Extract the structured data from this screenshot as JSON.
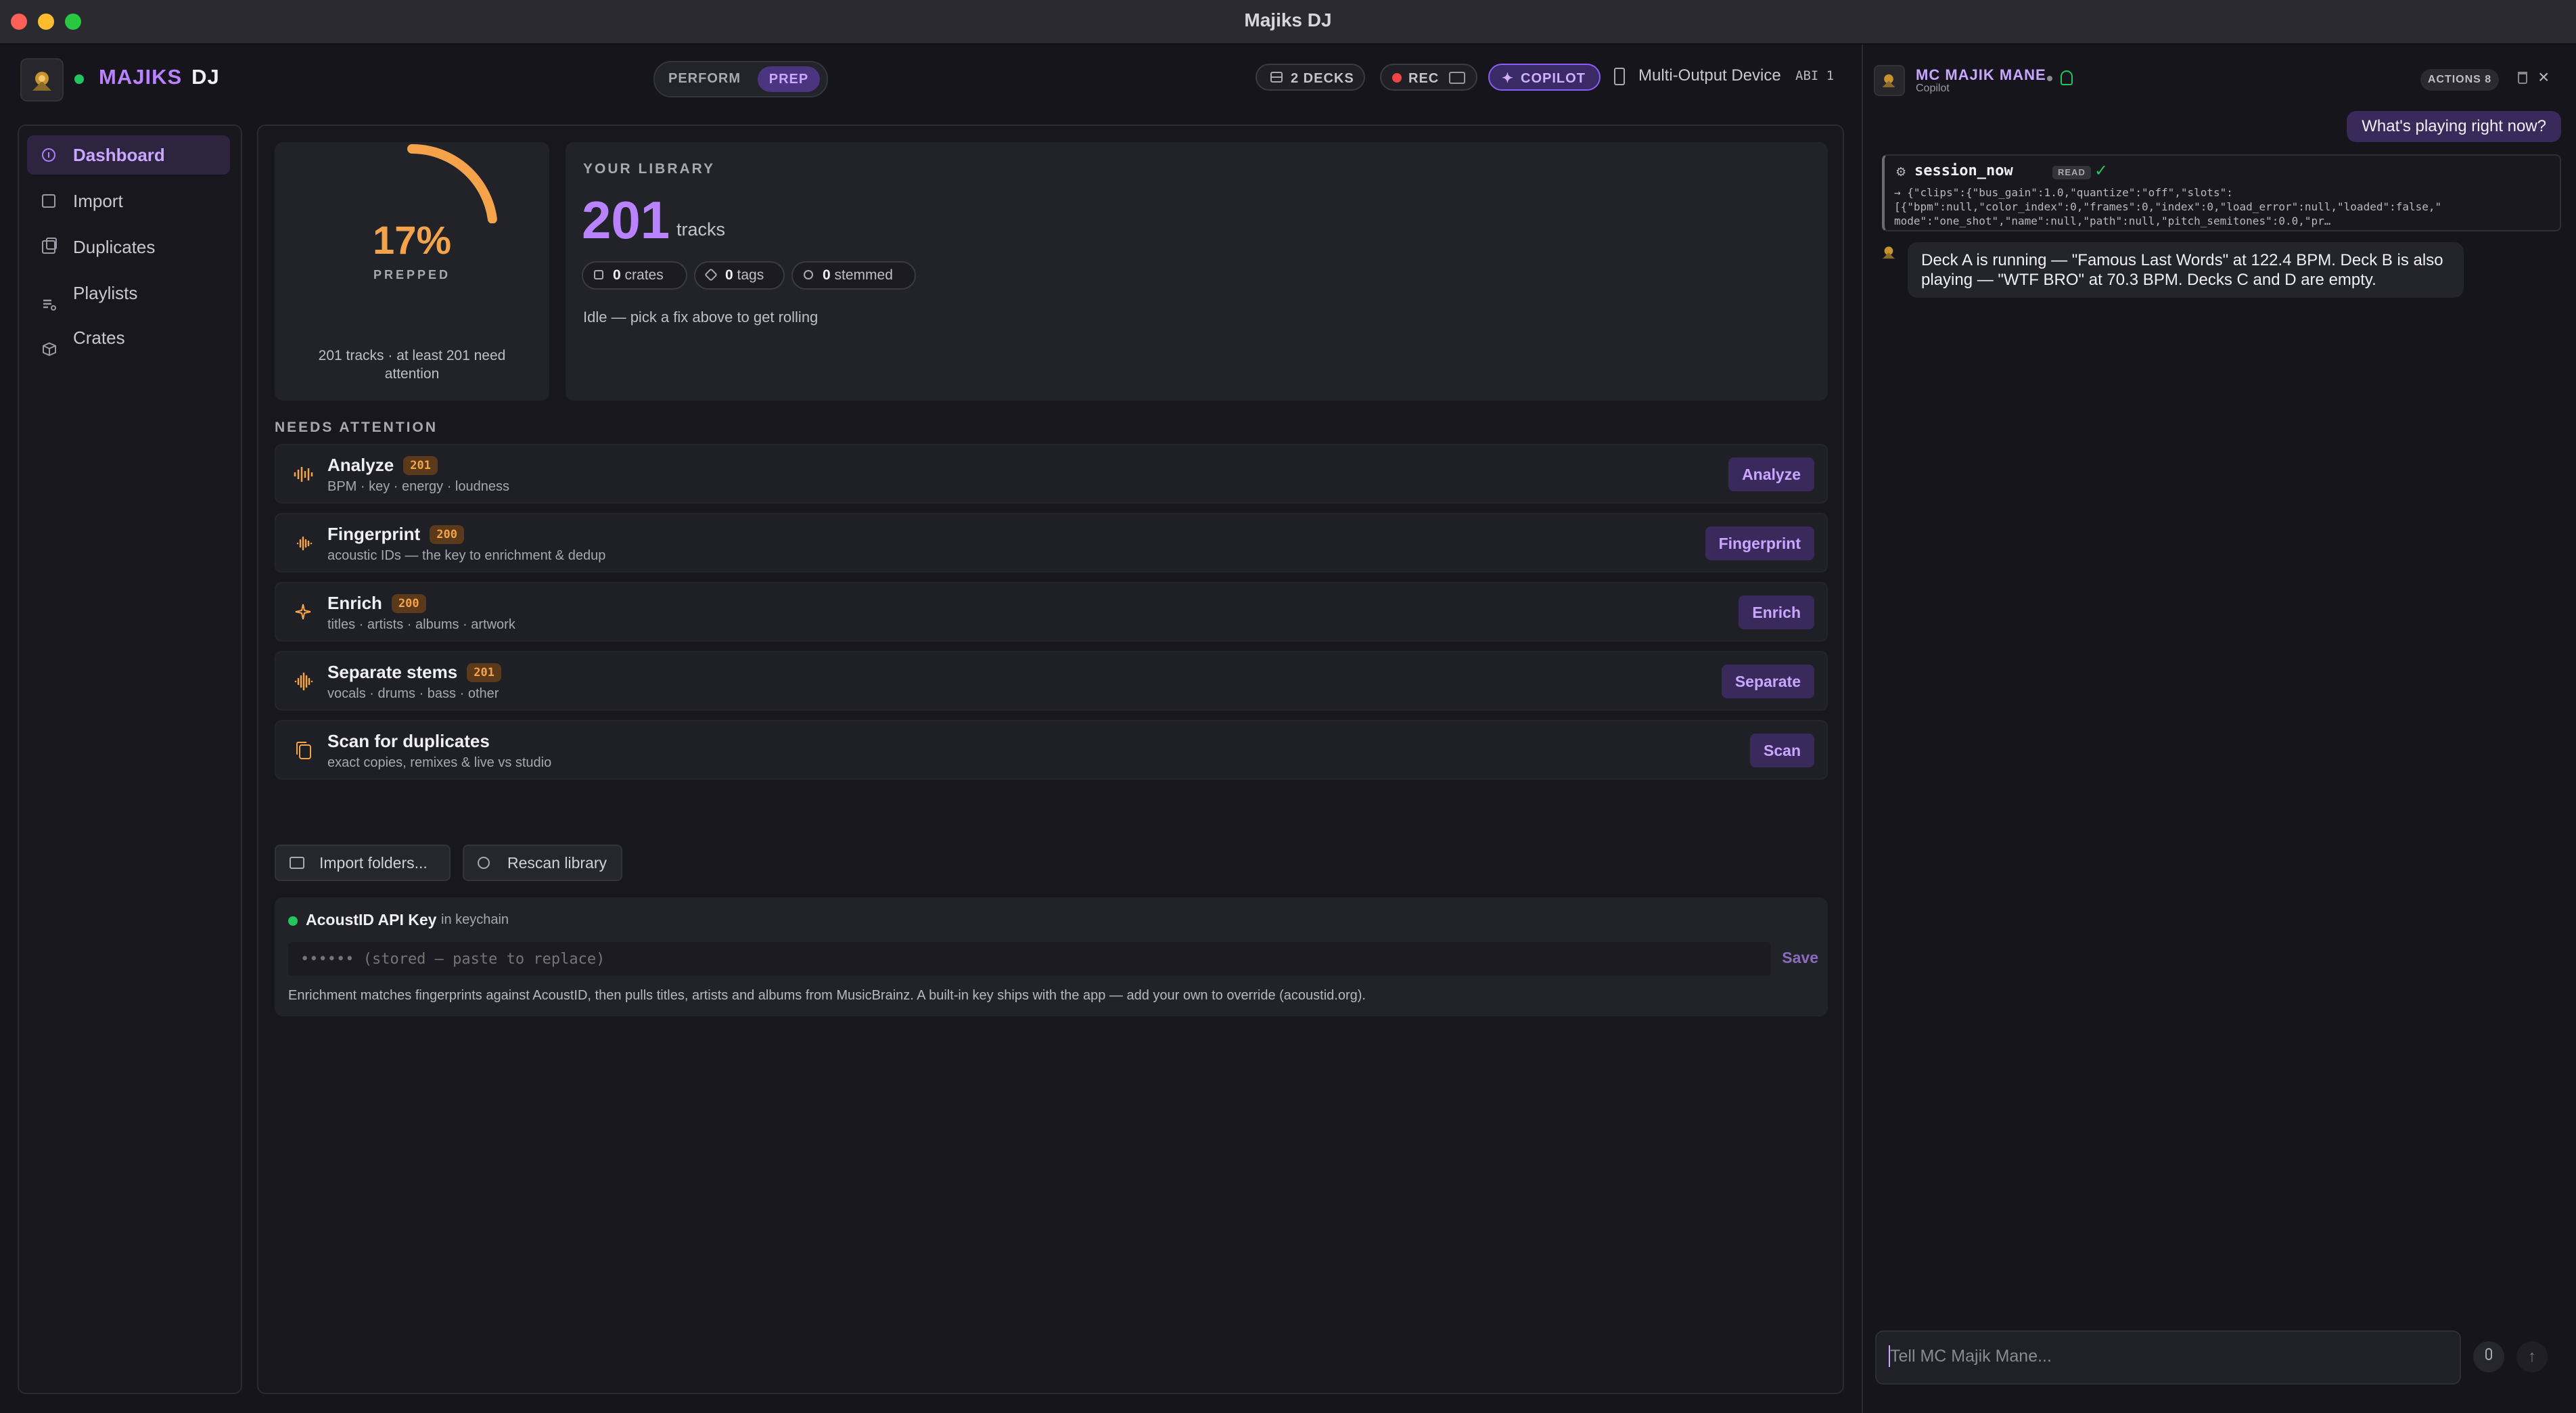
{
  "window": {
    "title": "Majiks DJ"
  },
  "header": {
    "brand_part1": "MAJIKS",
    "brand_part2": "DJ",
    "mode_perform": "PERFORM",
    "mode_prep": "PREP",
    "decks_label": "2 DECKS",
    "rec_label": "REC",
    "copilot_label": "COPILOT",
    "output_device": "Multi-Output Device",
    "abi_label": "ABI 1"
  },
  "sidebar": {
    "items": [
      {
        "label": "Dashboard",
        "icon": "dashboard-icon",
        "active": true
      },
      {
        "label": "Import",
        "icon": "import-icon"
      },
      {
        "label": "Duplicates",
        "icon": "duplicates-icon"
      },
      {
        "label": "Playlists",
        "icon": "playlists-icon"
      },
      {
        "label": "Crates",
        "icon": "crates-icon"
      }
    ]
  },
  "prep": {
    "percent_label": "17%",
    "progress_fraction": 0.17,
    "label": "PREPPED",
    "note": "201 tracks · at least 201 need attention"
  },
  "library": {
    "title": "YOUR LIBRARY",
    "count": "201",
    "unit": "tracks",
    "chips": [
      {
        "value": "0",
        "label": "crates"
      },
      {
        "value": "0",
        "label": "tags"
      },
      {
        "value": "0",
        "label": "stemmed"
      }
    ],
    "status": "Idle — pick a fix above to get rolling"
  },
  "attention": {
    "title": "NEEDS ATTENTION",
    "tasks": [
      {
        "name": "Analyze",
        "badge": "201",
        "desc": "BPM · key · energy · loudness",
        "button": "Analyze"
      },
      {
        "name": "Fingerprint",
        "badge": "200",
        "desc": "acoustic IDs — the key to enrichment & dedup",
        "button": "Fingerprint"
      },
      {
        "name": "Enrich",
        "badge": "200",
        "desc": "titles · artists · albums · artwork",
        "button": "Enrich"
      },
      {
        "name": "Separate stems",
        "badge": "201",
        "desc": "vocals · drums · bass · other",
        "button": "Separate"
      },
      {
        "name": "Scan for duplicates",
        "badge": "",
        "desc": "exact copies, remixes & live vs studio",
        "button": "Scan"
      }
    ],
    "import_button": "Import folders...",
    "rescan_button": "Rescan library"
  },
  "acoustid": {
    "title": "AcoustID API Key",
    "subtitle": "in keychain",
    "placeholder": "•••••• (stored — paste to replace)",
    "save": "Save",
    "note": "Enrichment matches fingerprints against AcoustID, then pulls titles, artists and albums from MusicBrainz. A built-in key ships with the app — add your own to override (acoustid.org)."
  },
  "copilot": {
    "name": "MC MAJIK MANE",
    "subtitle": "Copilot",
    "actions_label": "ACTIONS 8",
    "user_message": "What's playing right now?",
    "tool": {
      "name": "session_now",
      "badge": "READ",
      "check": "✓",
      "json_line1": "→ {\"clips\":{\"bus_gain\":1.0,\"quantize\":\"off\",\"slots\":",
      "json_line2": "[{\"bpm\":null,\"color_index\":0,\"frames\":0,\"index\":0,\"load_error\":null,\"loaded\":false,\"",
      "json_line3": "mode\":\"one_shot\",\"name\":null,\"path\":null,\"pitch_semitones\":0.0,\"pr…"
    },
    "bot_message": "Deck A is running — \"Famous Last Words\" at 122.4 BPM. Deck B is also playing — \"WTF BRO\" at 70.3 BPM. Decks C and D are empty.",
    "input_placeholder": "Tell MC Majik Mane..."
  },
  "colors": {
    "accent": "#b983ff",
    "orange": "#f5a34b",
    "green": "#22c55e",
    "rec": "#ef4444"
  }
}
